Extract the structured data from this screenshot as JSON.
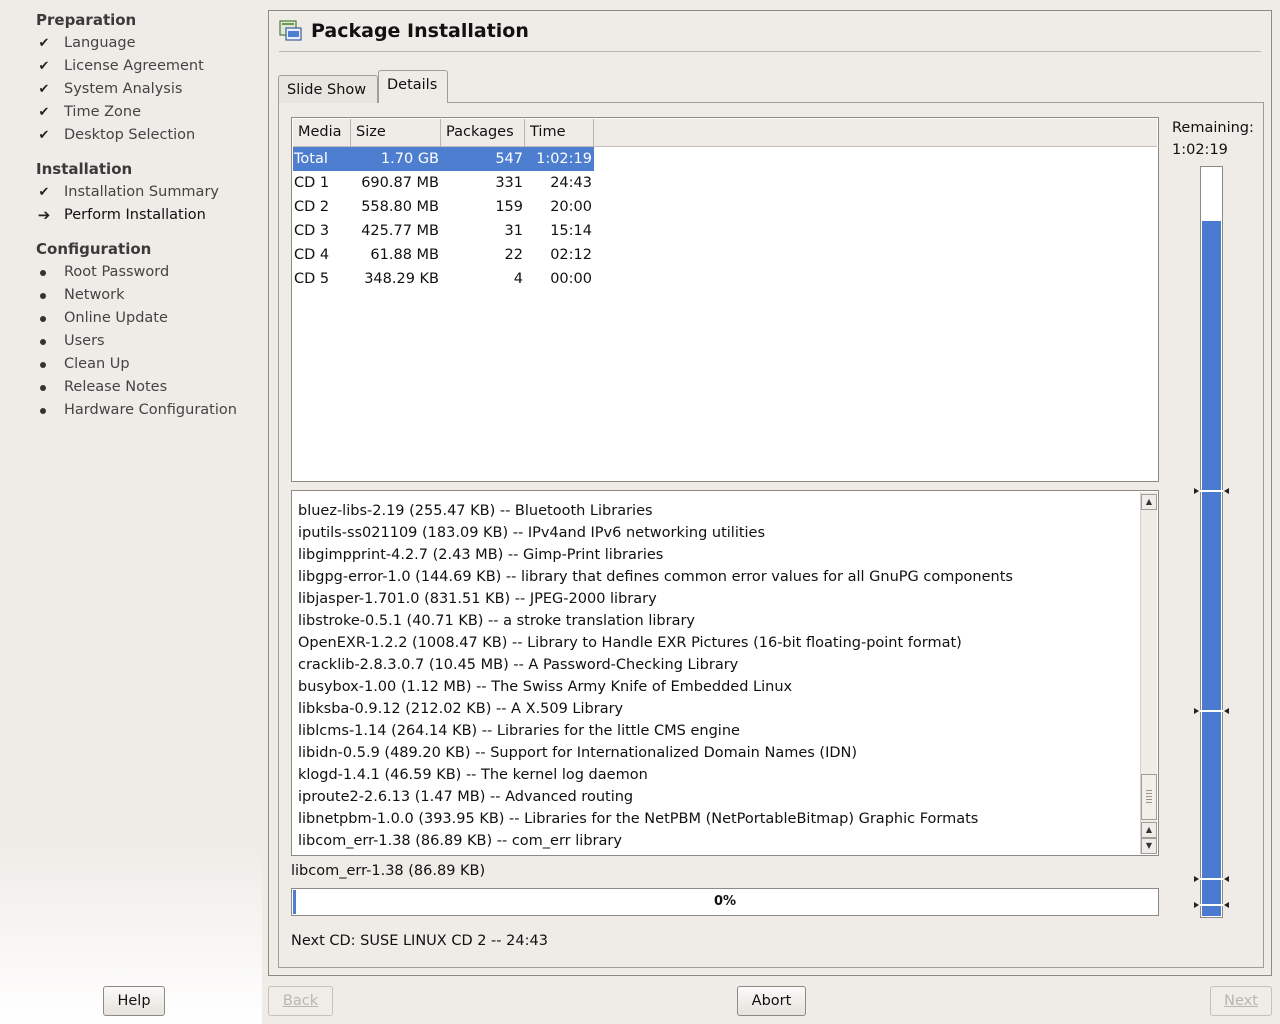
{
  "sidebar": {
    "groups": [
      {
        "title": "Preparation",
        "steps": [
          {
            "label": "Language",
            "state": "done"
          },
          {
            "label": "License Agreement",
            "state": "done"
          },
          {
            "label": "System Analysis",
            "state": "done"
          },
          {
            "label": "Time Zone",
            "state": "done"
          },
          {
            "label": "Desktop Selection",
            "state": "done"
          }
        ]
      },
      {
        "title": "Installation",
        "steps": [
          {
            "label": "Installation Summary",
            "state": "done"
          },
          {
            "label": "Perform Installation",
            "state": "current"
          }
        ]
      },
      {
        "title": "Configuration",
        "steps": [
          {
            "label": "Root Password",
            "state": "todo"
          },
          {
            "label": "Network",
            "state": "todo"
          },
          {
            "label": "Online Update",
            "state": "todo"
          },
          {
            "label": "Users",
            "state": "todo"
          },
          {
            "label": "Clean Up",
            "state": "todo"
          },
          {
            "label": "Release Notes",
            "state": "todo"
          },
          {
            "label": "Hardware Configuration",
            "state": "todo"
          }
        ]
      }
    ],
    "icons": {
      "done": "check-icon",
      "current": "arrow-right-icon",
      "todo": "bullet-icon"
    }
  },
  "main": {
    "title": "Package Installation",
    "title_icon": "package-install-icon",
    "tabs": [
      {
        "label": "Slide Show",
        "active": false
      },
      {
        "label": "Details",
        "active": true
      }
    ],
    "table": {
      "columns": [
        "Media",
        "Size",
        "Packages",
        "Time"
      ],
      "rows": [
        {
          "media": "Total",
          "size": "1.70 GB",
          "packages": "547",
          "time": "1:02:19",
          "selected": true
        },
        {
          "media": "CD 1",
          "size": "690.87 MB",
          "packages": "331",
          "time": "24:43"
        },
        {
          "media": "CD 2",
          "size": "558.80 MB",
          "packages": "159",
          "time": "20:00"
        },
        {
          "media": "CD 3",
          "size": "425.77 MB",
          "packages": "31",
          "time": "15:14"
        },
        {
          "media": "CD 4",
          "size": "61.88 MB",
          "packages": "22",
          "time": "02:12"
        },
        {
          "media": "CD 5",
          "size": "348.29 KB",
          "packages": "4",
          "time": "00:00"
        }
      ]
    },
    "log": [
      "bluez-libs-2.19 (255.47 KB) -- Bluetooth Libraries",
      "iputils-ss021109 (183.09 KB) -- IPv4and IPv6 networking utilities",
      "libgimpprint-4.2.7 (2.43 MB) -- Gimp-Print libraries",
      "libgpg-error-1.0 (144.69 KB) -- library that defines common error values for all GnuPG components",
      "libjasper-1.701.0 (831.51 KB) -- JPEG-2000 library",
      "libstroke-0.5.1 (40.71 KB) -- a stroke translation library",
      "OpenEXR-1.2.2 (1008.47 KB) -- Library to Handle EXR Pictures (16-bit floating-point format)",
      "cracklib-2.8.3.0.7 (10.45 MB) -- A Password-Checking Library",
      "busybox-1.00 (1.12 MB) -- The Swiss Army Knife of Embedded Linux",
      "libksba-0.9.12 (212.02 KB) -- A X.509 Library",
      "liblcms-1.14 (264.14 KB) -- Libraries for the little CMS engine",
      "libidn-0.5.9 (489.20 KB) -- Support for Internationalized Domain Names (IDN)",
      "klogd-1.4.1 (46.59 KB) -- The kernel log daemon",
      "iproute2-2.6.13 (1.47 MB) -- Advanced routing",
      "libnetpbm-1.0.0 (393.95 KB) -- Libraries for the NetPBM (NetPortableBitmap) Graphic Formats",
      "libcom_err-1.38 (86.89 KB) -- com_err library"
    ],
    "current_package": "libcom_err-1.38 (86.89 KB)",
    "progress": {
      "percent": 0,
      "text": "0%"
    },
    "next_cd": "Next CD: SUSE LINUX CD 2 -- 24:43",
    "remaining": {
      "label": "Remaining:",
      "time": "1:02:19",
      "fraction": 0.93
    }
  },
  "buttons": {
    "help": "Help",
    "back": "Back",
    "abort": "Abort",
    "next": "Next"
  },
  "colors": {
    "selection": "#4d7ed0",
    "progress": "#4a7bd0",
    "background": "#efebe7"
  }
}
